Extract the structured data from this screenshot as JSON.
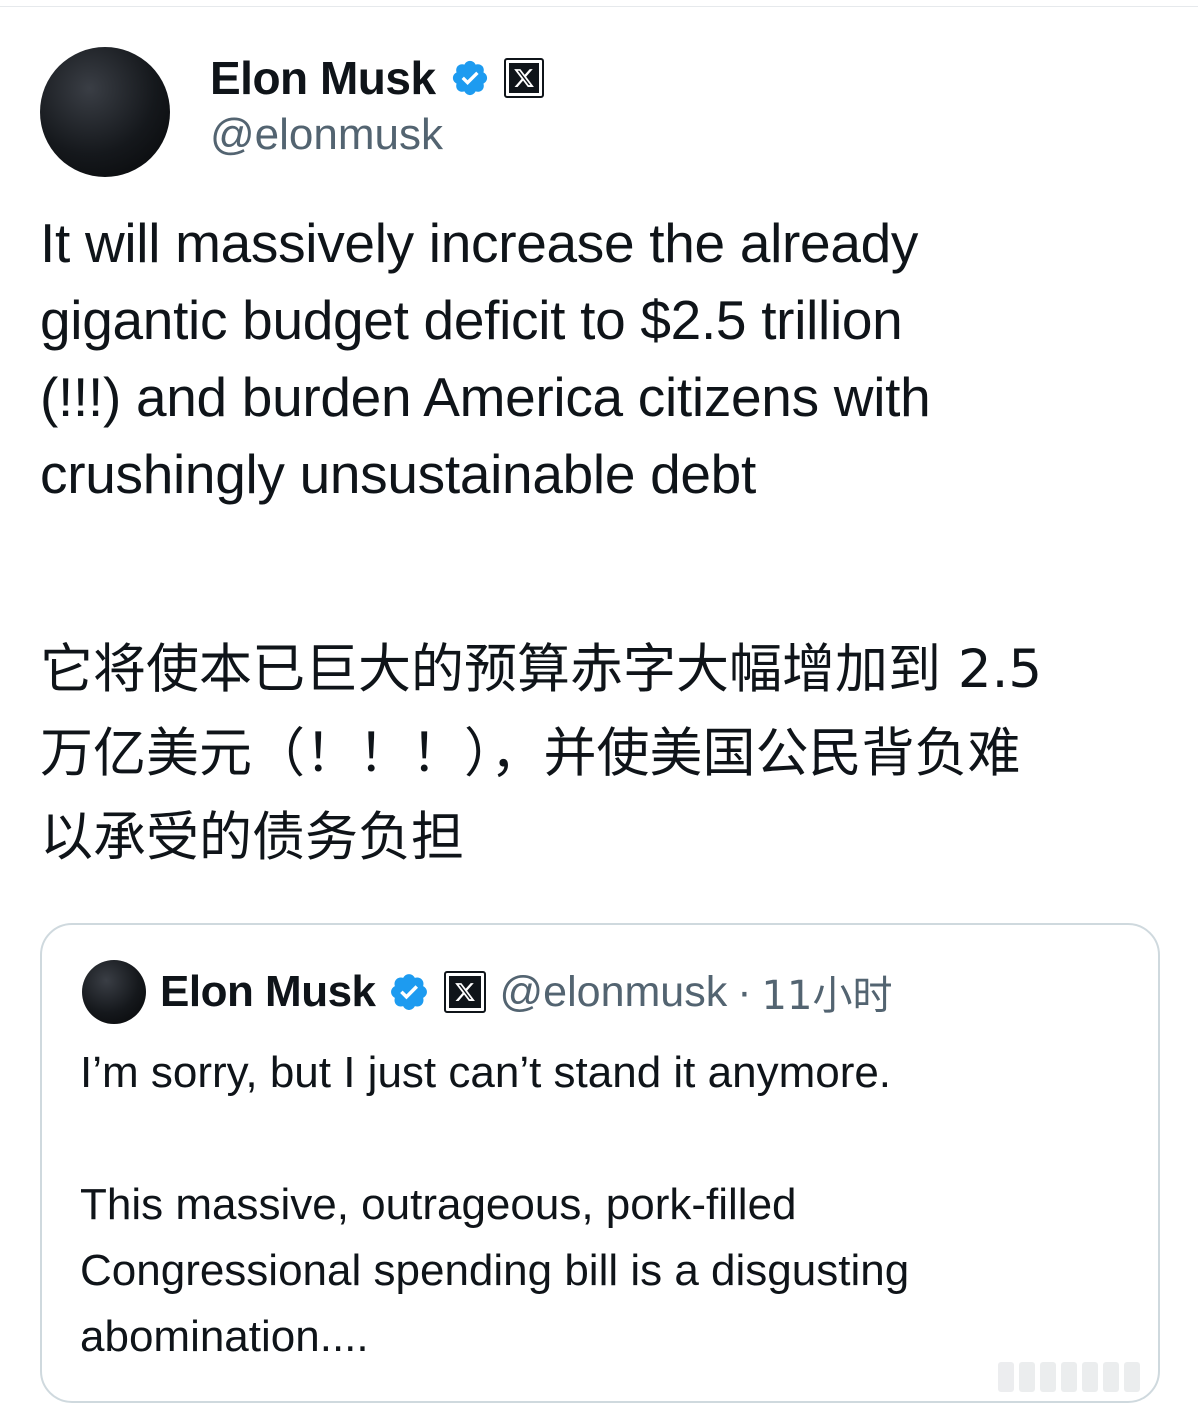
{
  "author": {
    "display_name": "Elon Musk",
    "handle": "@elonmusk",
    "verified_icon": "verified-badge-icon",
    "affiliation_icon": "x-logo-icon"
  },
  "tweet": {
    "text_en": "It will massively increase the already\ngigantic budget deficit to $2.5 trillion\n(!!!) and burden America citizens with\ncrushingly unsustainable debt",
    "text_zh": "它将使本已巨大的预算赤字大幅增加到 2.5\n万亿美元（！！！），并使美国公民背负难\n以承受的债务负担"
  },
  "quoted_tweet": {
    "display_name": "Elon Musk",
    "handle": "@elonmusk",
    "separator": "·",
    "time": "11小时",
    "text": "I’m sorry, but I just can’t stand it anymore.\n\nThis massive, outrageous, pork-filled\nCongressional spending bill is a disgusting\nabomination...."
  },
  "colors": {
    "text_primary": "#0f1419",
    "text_secondary": "#536471",
    "verified_blue": "#1d9bf0",
    "card_border": "#cfd9de"
  }
}
